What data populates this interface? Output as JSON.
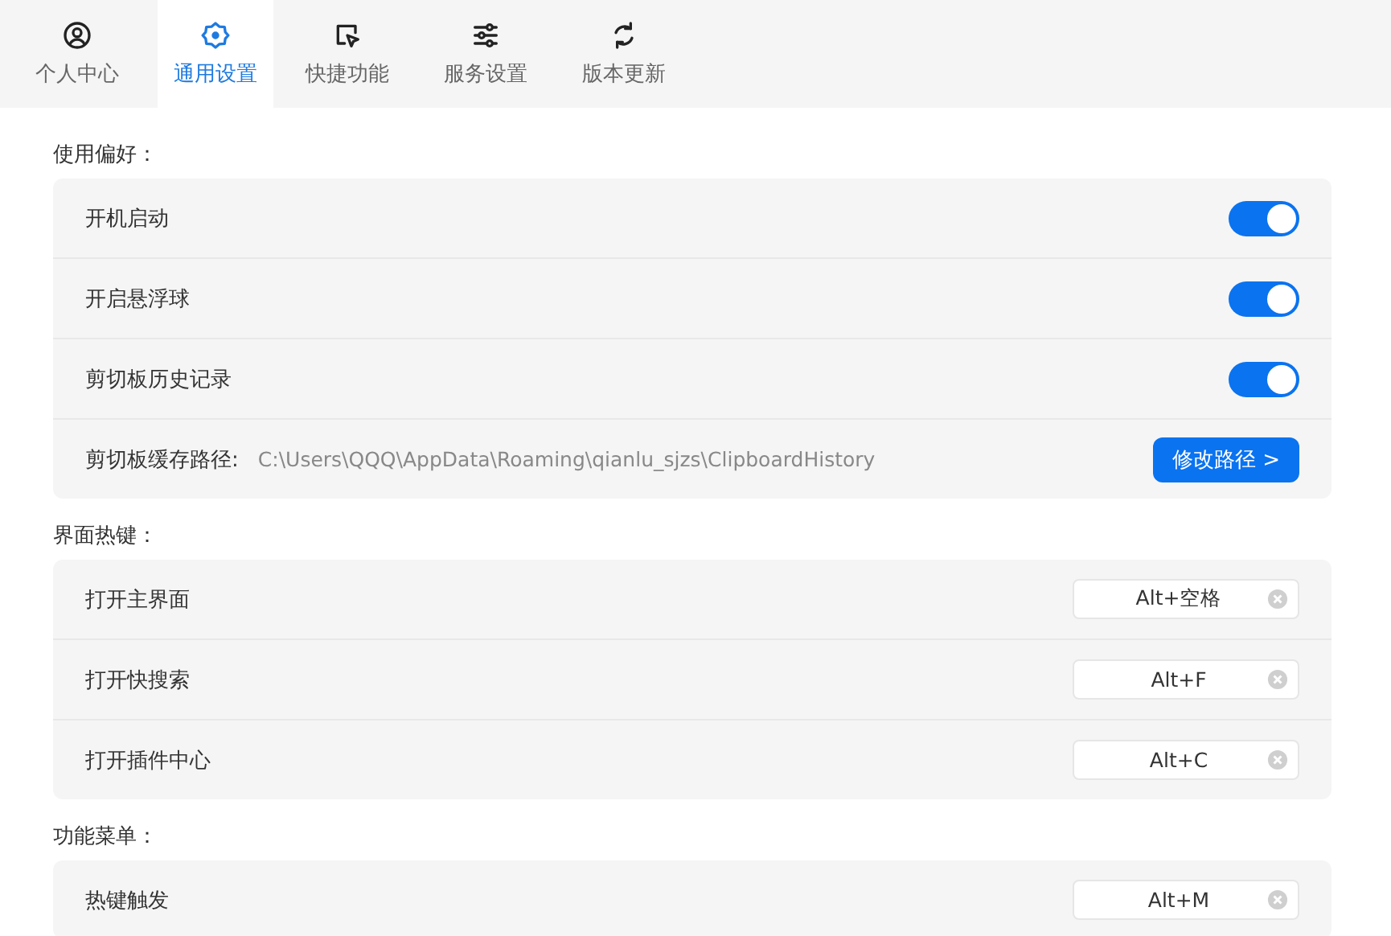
{
  "tabs": [
    {
      "label": "个人中心",
      "kind": "user",
      "selected": false
    },
    {
      "label": "通用设置",
      "kind": "gear",
      "selected": true
    },
    {
      "label": "快捷功能",
      "kind": "pointer",
      "selected": false
    },
    {
      "label": "服务设置",
      "kind": "sliders",
      "selected": false
    },
    {
      "label": "版本更新",
      "kind": "refresh",
      "selected": false
    }
  ],
  "sections": [
    {
      "title": "使用偏好：",
      "rows": [
        {
          "kind": "toggle",
          "label": "开机启动",
          "on": true
        },
        {
          "kind": "toggle",
          "label": "开启悬浮球",
          "on": true
        },
        {
          "kind": "toggle",
          "label": "剪切板历史记录",
          "on": true
        },
        {
          "kind": "path",
          "label": "剪切板缓存路径:",
          "value": "C:\\Users\\QQQ\\AppData\\Roaming\\qianlu_sjzs\\ClipboardHistory",
          "button": "修改路径 >"
        }
      ]
    },
    {
      "title": "界面热键：",
      "rows": [
        {
          "kind": "hotkey",
          "label": "打开主界面",
          "value": "Alt+空格"
        },
        {
          "kind": "hotkey",
          "label": "打开快搜索",
          "value": "Alt+F"
        },
        {
          "kind": "hotkey",
          "label": "打开插件中心",
          "value": "Alt+C"
        }
      ]
    },
    {
      "title": "功能菜单：",
      "rows": [
        {
          "kind": "hotkey",
          "label": "热键触发",
          "value": "Alt+M"
        }
      ]
    }
  ]
}
